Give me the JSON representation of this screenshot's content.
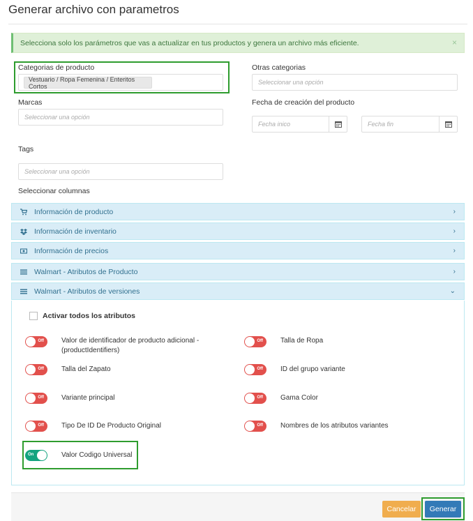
{
  "modal": {
    "title": "Generar archivo con parametros"
  },
  "alert": {
    "text": "Selecciona solo los parámetros que vas a actualizar en tus productos y genera un archivo más eficiente.",
    "close": "×"
  },
  "form": {
    "categorias": {
      "label": "Categorias de producto",
      "chip": "Vestuario / Ropa Femenina / Enteritos Cortos"
    },
    "otras": {
      "label": "Otras categorias",
      "placeholder": "Seleccionar una opción"
    },
    "marcas": {
      "label": "Marcas",
      "placeholder": "Seleccionar una opción"
    },
    "fecha": {
      "label": "Fecha de creación del producto",
      "inicio_placeholder": "Fecha inico",
      "fin_placeholder": "Fecha fin"
    },
    "tags": {
      "label": "Tags",
      "placeholder": "Seleccionar una opción"
    },
    "columnas_label": "Seleccionar columnas"
  },
  "accordion": [
    {
      "label": "Información de producto",
      "icon": "cart-icon",
      "expanded": false
    },
    {
      "label": "Información de inventario",
      "icon": "dropbox-icon",
      "expanded": false
    },
    {
      "label": "Información de precios",
      "icon": "money-icon",
      "expanded": false
    },
    {
      "label": "Walmart - Atributos de Producto",
      "icon": "list-icon",
      "expanded": false
    },
    {
      "label": "Walmart - Atributos de versiones",
      "icon": "list-icon",
      "expanded": true
    }
  ],
  "attributes": {
    "activate_all": "Activar todos los atributos",
    "items": [
      {
        "label": "Valor de identificador de producto adicional - (productIdentifiers)",
        "state": "Off"
      },
      {
        "label": "Talla de Ropa",
        "state": "Off"
      },
      {
        "label": "Talla del Zapato",
        "state": "Off"
      },
      {
        "label": "ID del grupo variante",
        "state": "Off"
      },
      {
        "label": "Variante principal",
        "state": "Off"
      },
      {
        "label": "Gama Color",
        "state": "Off"
      },
      {
        "label": "Tipo De ID De Producto Original",
        "state": "Off"
      },
      {
        "label": "Nombres de los atributos variantes",
        "state": "Off"
      },
      {
        "label": "Valor Codigo Universal",
        "state": "On"
      }
    ]
  },
  "footer": {
    "cancel": "Cancelar",
    "generate": "Generar"
  },
  "colors": {
    "toggle_off": "#e2504c",
    "toggle_on": "#14a37f",
    "highlight": "#2e9c2e",
    "cancel": "#f0ad4e",
    "generate": "#337ab7"
  }
}
